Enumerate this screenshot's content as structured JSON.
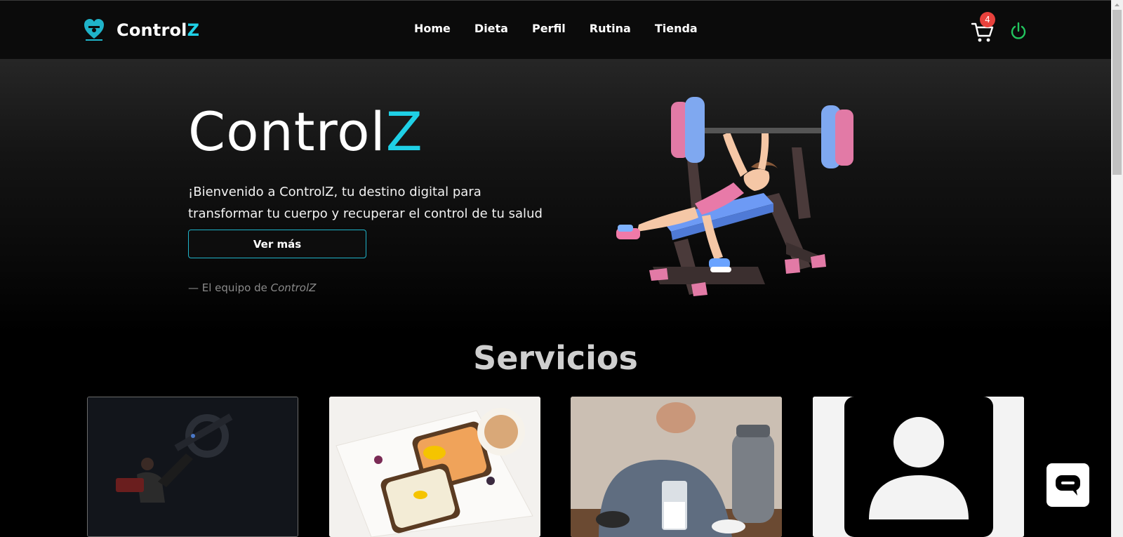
{
  "nav": {
    "brand_prefix": "Control",
    "brand_accent": "Z",
    "links": [
      "Home",
      "Dieta",
      "Perfil",
      "Rutina",
      "Tienda"
    ],
    "cart_count": "4"
  },
  "hero": {
    "title_prefix": "Control",
    "title_accent": "Z",
    "text": "¡Bienvenido a ControlZ, tu destino digital para transformar tu cuerpo y recuperar el control de tu salud y bienestar!",
    "button_label": "Ver más",
    "signature_prefix": "— El equipo de ",
    "signature_brand": "ControlZ"
  },
  "services": {
    "title": "Servicios"
  },
  "colors": {
    "accent": "#1fd0e6",
    "badge": "#e8413c",
    "power": "#22c55e"
  },
  "icons": [
    "logo-icon",
    "cart-icon",
    "power-icon",
    "chat-icon",
    "avatar-icon"
  ]
}
